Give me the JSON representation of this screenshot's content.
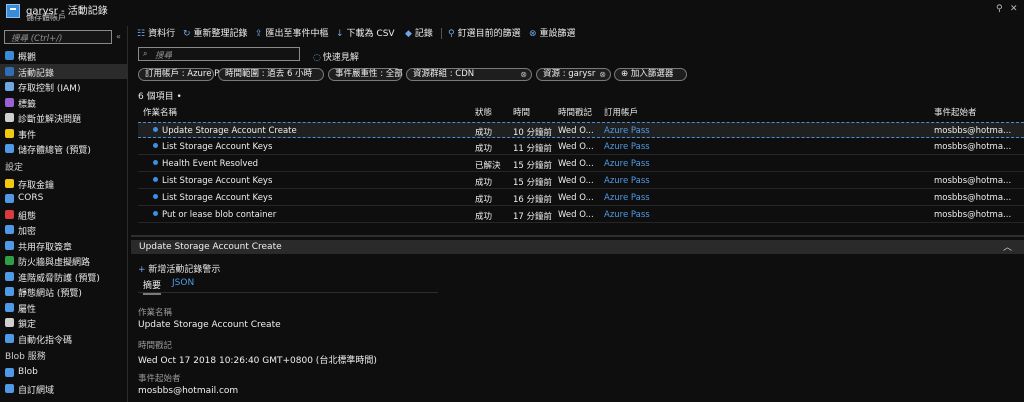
{
  "window": {
    "title": "garysr - 活動記錄",
    "subtitle": "儲存體帳戶"
  },
  "sidebar": {
    "search_placeholder": "搜尋 (Ctrl+/)",
    "collapse_glyph": "«",
    "items": [
      {
        "label": "概觀",
        "icon": "overview-icon",
        "color": "#3a8bd8"
      },
      {
        "label": "活動記錄",
        "icon": "activity-log-icon",
        "color": "#2f6db5",
        "active": true
      },
      {
        "label": "存取控制 (IAM)",
        "icon": "people-icon",
        "color": "#6fa7e4"
      },
      {
        "label": "標籤",
        "icon": "tag-icon",
        "color": "#9b5fd6"
      },
      {
        "label": "診斷並解決問題",
        "icon": "wrench-icon",
        "color": "#cfcfcf"
      },
      {
        "label": "事件",
        "icon": "lightning-icon",
        "color": "#f2c811"
      },
      {
        "label": "儲存體總管 (預覽)",
        "icon": "storage-explorer-icon",
        "color": "#4f9ae6"
      }
    ],
    "section_settings": "設定",
    "settings_items": [
      {
        "label": "存取金鑰",
        "icon": "key-icon",
        "color": "#f2c811"
      },
      {
        "label": "CORS",
        "icon": "cors-icon",
        "color": "#4f9ae6"
      },
      {
        "label": "組態",
        "icon": "configuration-icon",
        "color": "#d83b3b"
      },
      {
        "label": "加密",
        "icon": "lock-icon",
        "color": "#4f9ae6"
      },
      {
        "label": "共用存取簽章",
        "icon": "link-icon",
        "color": "#4f9ae6"
      },
      {
        "label": "防火牆與虛擬網路",
        "icon": "firewall-icon",
        "color": "#2f9e44"
      },
      {
        "label": "進階威脅防護 (預覽)",
        "icon": "shield-icon",
        "color": "#4f9ae6"
      },
      {
        "label": "靜態網站 (預覽)",
        "icon": "website-icon",
        "color": "#4f9ae6"
      },
      {
        "label": "屬性",
        "icon": "properties-icon",
        "color": "#4f9ae6"
      },
      {
        "label": "鎖定",
        "icon": "padlock-icon",
        "color": "#cfcfcf"
      },
      {
        "label": "自動化指令碼",
        "icon": "script-icon",
        "color": "#4f9ae6"
      }
    ],
    "section_blob": "Blob 服務",
    "blob_items": [
      {
        "label": "Blob",
        "icon": "blob-icon",
        "color": "#4f9ae6"
      },
      {
        "label": "自訂網域",
        "icon": "domain-icon",
        "color": "#4f9ae6"
      }
    ]
  },
  "toolbar": {
    "buttons": [
      {
        "label": "資料行",
        "icon": "columns-icon",
        "glyph": "☷"
      },
      {
        "label": "重新整理記錄",
        "icon": "refresh-icon",
        "glyph": "↻"
      },
      {
        "label": "匯出至事件中樞",
        "icon": "export-icon",
        "glyph": "⇪"
      },
      {
        "label": "下載為 CSV",
        "icon": "download-icon",
        "glyph": "↓"
      },
      {
        "label": "記錄",
        "icon": "logs-icon",
        "glyph": "◆"
      },
      {
        "label": "釘選目前的篩選",
        "icon": "pin-icon",
        "glyph": "⚲"
      },
      {
        "label": "重設篩選",
        "icon": "reset-filter-icon",
        "glyph": "⊗"
      }
    ]
  },
  "main": {
    "search_placeholder": "搜尋",
    "quick_insights": "快速見解",
    "filters": [
      "訂用帳戶 : Azure Pass",
      "時間範圍 : 過去 6 小時",
      "事件嚴重性 : 全部",
      "資源群組 : CDN",
      "資源 : garysr"
    ],
    "add_filter": "加入篩選器",
    "item_count": "6 個項目 •",
    "columns": [
      "作業名稱",
      "狀態",
      "時間",
      "時間戳記",
      "訂用帳戶",
      "事件起始者"
    ],
    "rows": [
      {
        "name": "Update Storage Account Create",
        "status": "成功",
        "time": "10 分鐘前",
        "timestamp": "Wed O...",
        "subscription": "Azure Pass",
        "initiator": "mosbbs@hotma..."
      },
      {
        "name": "List Storage Account Keys",
        "status": "成功",
        "time": "11 分鐘前",
        "timestamp": "Wed O...",
        "subscription": "Azure Pass",
        "initiator": "mosbbs@hotma..."
      },
      {
        "name": "Health Event Resolved",
        "status": "已解決",
        "time": "15 分鐘前",
        "timestamp": "Wed O...",
        "subscription": "Azure Pass",
        "initiator": ""
      },
      {
        "name": "List Storage Account Keys",
        "status": "成功",
        "time": "15 分鐘前",
        "timestamp": "Wed O...",
        "subscription": "Azure Pass",
        "initiator": "mosbbs@hotma..."
      },
      {
        "name": "List Storage Account Keys",
        "status": "成功",
        "time": "16 分鐘前",
        "timestamp": "Wed O...",
        "subscription": "Azure Pass",
        "initiator": "mosbbs@hotma..."
      },
      {
        "name": "Put or lease blob container",
        "status": "成功",
        "time": "17 分鐘前",
        "timestamp": "Wed O...",
        "subscription": "Azure Pass",
        "initiator": "mosbbs@hotma..."
      }
    ]
  },
  "detail": {
    "title": "Update Storage Account Create",
    "new_alert": "新增活動記錄警示",
    "tabs": [
      "摘要",
      "JSON"
    ],
    "fields": [
      {
        "label": "作業名稱",
        "value": "Update Storage Account Create"
      },
      {
        "label": "時間戳記",
        "value": "Wed Oct 17 2018 10:26:40 GMT+0800 (台北標準時間)"
      },
      {
        "label": "事件起始者",
        "value": "mosbbs@hotmail.com"
      }
    ]
  }
}
